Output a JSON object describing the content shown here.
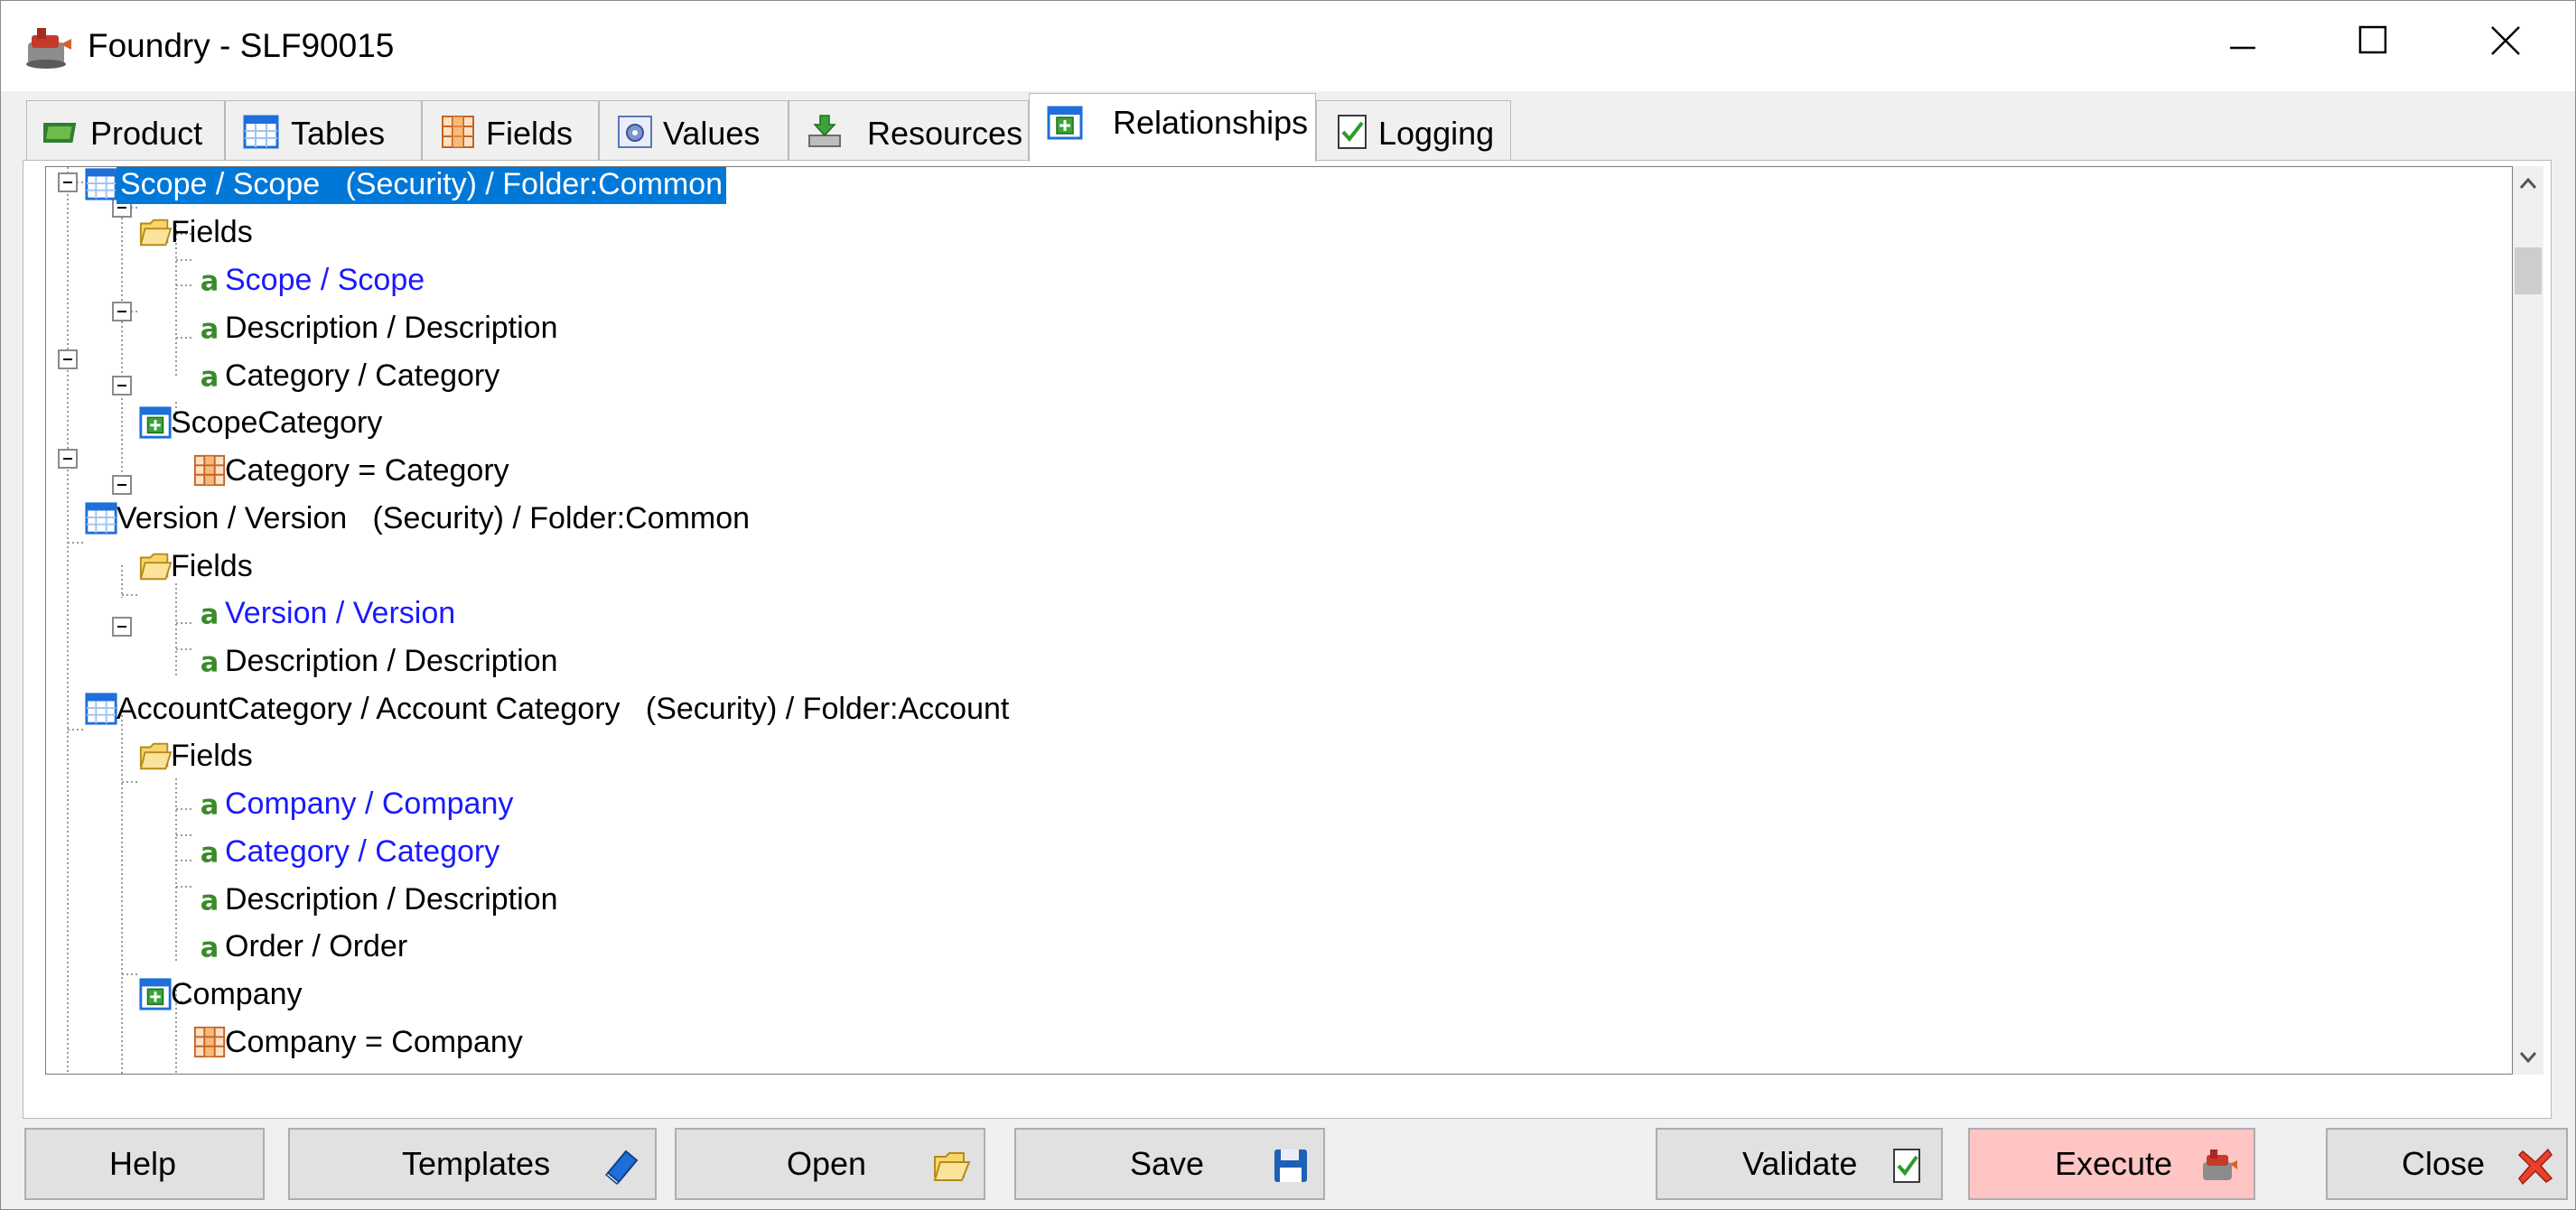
{
  "window": {
    "title": "Foundry - SLF90015",
    "icon": "foundry-icon",
    "controls": [
      "minimize-icon",
      "maximize-icon",
      "close-icon"
    ]
  },
  "tabs": [
    {
      "label": "Product",
      "icon": "product-icon"
    },
    {
      "label": "Tables",
      "icon": "table-icon"
    },
    {
      "label": "Fields",
      "icon": "fields-grid-icon"
    },
    {
      "label": "Values",
      "icon": "values-icon"
    },
    {
      "label": "Resources",
      "icon": "resources-icon"
    },
    {
      "label": "Relationships",
      "icon": "relationship-icon",
      "active": true
    },
    {
      "label": "Logging",
      "icon": "checklist-icon"
    }
  ],
  "tree": {
    "nodes": [
      {
        "label": "Scope / Scope   (Security) / Folder:Common",
        "icon": "table-icon",
        "selected": true
      },
      {
        "label": "Fields",
        "icon": "folder-icon"
      },
      {
        "label": "Scope / Scope",
        "icon": "field-a-icon",
        "key": true
      },
      {
        "label": "Description / Description",
        "icon": "field-a-icon"
      },
      {
        "label": "Category / Category",
        "icon": "field-a-icon"
      },
      {
        "label": "ScopeCategory",
        "icon": "relationship-icon"
      },
      {
        "label": "Category = Category",
        "icon": "join-grid-icon"
      },
      {
        "label": "Version / Version   (Security) / Folder:Common",
        "icon": "table-icon"
      },
      {
        "label": "Fields",
        "icon": "folder-icon"
      },
      {
        "label": "Version / Version",
        "icon": "field-a-icon",
        "key": true
      },
      {
        "label": "Description / Description",
        "icon": "field-a-icon"
      },
      {
        "label": "AccountCategory / Account Category   (Security) / Folder:Account",
        "icon": "table-icon"
      },
      {
        "label": "Fields",
        "icon": "folder-icon"
      },
      {
        "label": "Company / Company",
        "icon": "field-a-icon",
        "key": true
      },
      {
        "label": "Category / Category",
        "icon": "field-a-icon",
        "key": true
      },
      {
        "label": "Description / Description",
        "icon": "field-a-icon"
      },
      {
        "label": "Order / Order",
        "icon": "field-a-icon"
      },
      {
        "label": "Company",
        "icon": "relationship-icon"
      },
      {
        "label": "Company = Company",
        "icon": "join-grid-icon"
      }
    ]
  },
  "buttons": {
    "help": "Help",
    "templates": "Templates",
    "open": "Open",
    "save": "Save",
    "validate": "Validate",
    "execute": "Execute",
    "close": "Close"
  },
  "colors": {
    "selection": "#0078d7",
    "key_field": "#1a1aff",
    "execute_bg": "#ffc4c4"
  }
}
